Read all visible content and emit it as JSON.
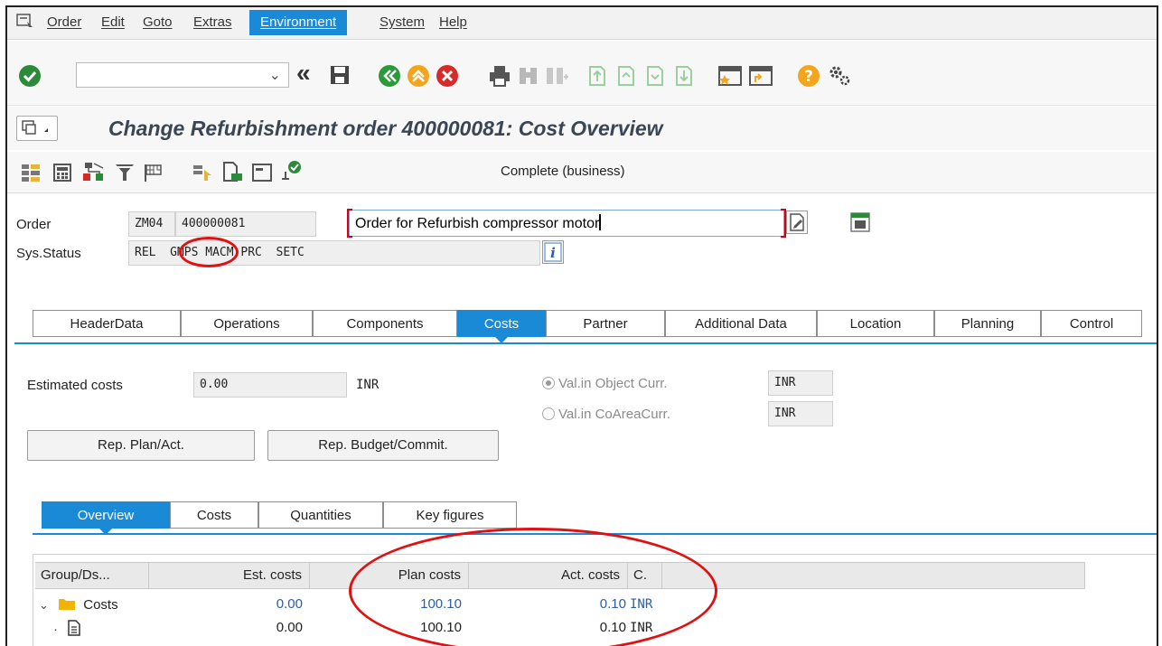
{
  "menu": {
    "items": [
      "Order",
      "Edit",
      "Goto",
      "Extras",
      "Environment",
      "System",
      "Help"
    ],
    "active": "Environment"
  },
  "toolbar": {
    "command_value": "",
    "icons": [
      "enter-check-icon",
      "dropdown-icon",
      "double-left-icon",
      "save-icon",
      "back-icon",
      "exit-icon",
      "cancel-icon",
      "print-icon",
      "find-icon",
      "find-next-icon",
      "first-page-icon",
      "prev-page-icon",
      "next-page-icon",
      "last-page-icon",
      "new-session-icon",
      "shortcut-icon",
      "help-icon",
      "settings-icon"
    ]
  },
  "title": "Change Refurbishment order 400000081: Cost Overview",
  "app_toolbar": {
    "status_text": "Complete (business)"
  },
  "header": {
    "order_label": "Order",
    "order_type": "ZM04",
    "order_number": "400000081",
    "order_description": "Order for Refurbish compressor motor",
    "sys_status_label": "Sys.Status",
    "sys_status_value": "REL  GMPS MACM PRC  SETC"
  },
  "tabs": [
    "HeaderData",
    "Operations",
    "Components",
    "Costs",
    "Partner",
    "Additional Data",
    "Location",
    "Planning",
    "Control"
  ],
  "active_tab": "Costs",
  "costs": {
    "estimated_label": "Estimated costs",
    "estimated_value": "0.00",
    "currency": "INR",
    "radio_obj_label": "Val.in Object Curr.",
    "radio_obj_curr": "INR",
    "radio_coarea_label": "Val.in CoAreaCurr.",
    "radio_coarea_curr": "INR",
    "btn_rep_plan": "Rep. Plan/Act.",
    "btn_rep_budget": "Rep. Budget/Commit."
  },
  "subtabs": [
    "Overview",
    "Costs",
    "Quantities",
    "Key figures"
  ],
  "active_subtab": "Overview",
  "table": {
    "headers": [
      "Group/Ds...",
      "Est. costs",
      "Plan costs",
      "Act. costs",
      "C."
    ],
    "rows": [
      {
        "label": "Costs",
        "est": "0.00",
        "plan": "100.10",
        "act": "0.10",
        "curr": "INR"
      },
      {
        "label": "",
        "est": "0.00",
        "plan": "100.10",
        "act": "0.10",
        "curr": "INR"
      }
    ]
  },
  "colors": {
    "accent": "#1b8ad6",
    "annotation": "#e21111",
    "title": "#3a4654",
    "value_blue": "#2a5ea8"
  }
}
